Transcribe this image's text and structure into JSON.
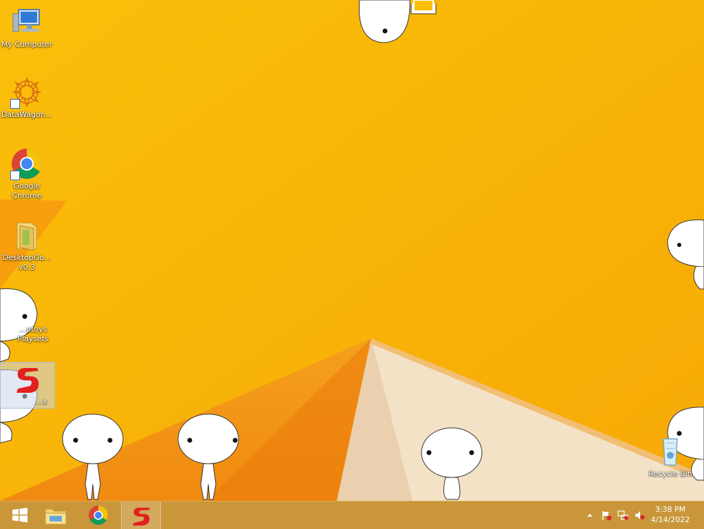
{
  "desktop": {
    "icons": [
      {
        "id": "my-computer",
        "label": "My Computer"
      },
      {
        "id": "datawagon",
        "label": "DataWagon..."
      },
      {
        "id": "google-chrome",
        "label": "Google Chrome"
      },
      {
        "id": "desktopgo",
        "label": "DesktopGo... v0.3"
      },
      {
        "id": "playsets",
        "label": "...ptoys Playsets"
      },
      {
        "id": "app-s",
        "label": "...x"
      },
      {
        "id": "recycle-bin",
        "label": "Recycle Bin"
      }
    ]
  },
  "taskbar": {
    "pinned": [
      {
        "name": "start-button",
        "icon": "windows-logo-icon"
      },
      {
        "name": "file-explorer",
        "icon": "folder-icon"
      },
      {
        "name": "chrome",
        "icon": "chrome-icon"
      },
      {
        "name": "app-s",
        "icon": "red-s-icon",
        "active": true
      }
    ],
    "tray": {
      "icons": [
        "show-hidden-icons-icon",
        "action-center-flag-icon",
        "network-icon",
        "volume-muted-icon"
      ],
      "time": "3:38 PM",
      "date": "4/14/2022"
    }
  },
  "colors": {
    "wallpaper": "#f8b400",
    "taskbar": "#c9973a",
    "red_s": "#e0211d"
  }
}
